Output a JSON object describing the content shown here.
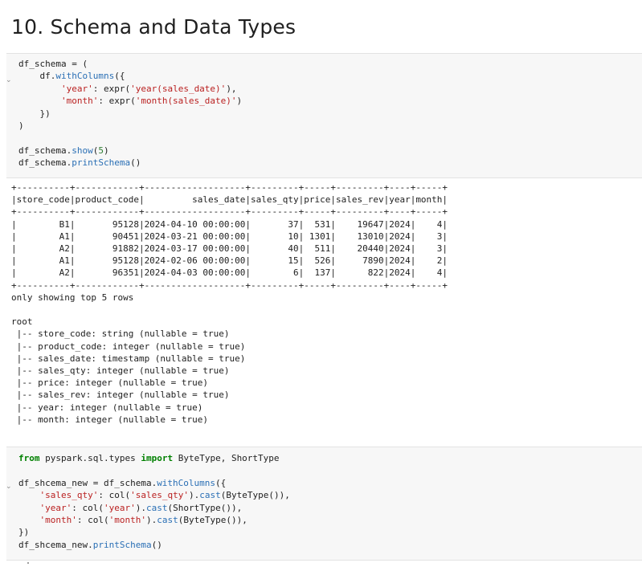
{
  "heading": "10. Schema and Data Types",
  "cell1": {
    "collapse_icon": "⌄",
    "lines": [
      [
        {
          "t": "df_schema = ("
        }
      ],
      [
        {
          "t": "    df."
        },
        {
          "t": "withColumns",
          "c": "fn"
        },
        {
          "t": "({"
        }
      ],
      [
        {
          "t": "        "
        },
        {
          "t": "'year'",
          "c": "st"
        },
        {
          "t": ": expr("
        },
        {
          "t": "'year(sales_date)'",
          "c": "st"
        },
        {
          "t": "),"
        }
      ],
      [
        {
          "t": "        "
        },
        {
          "t": "'month'",
          "c": "st"
        },
        {
          "t": ": expr("
        },
        {
          "t": "'month(sales_date)'",
          "c": "st"
        },
        {
          "t": ")"
        }
      ],
      [
        {
          "t": "    })"
        }
      ],
      [
        {
          "t": ")"
        }
      ],
      [
        {
          "t": ""
        }
      ],
      [
        {
          "t": "df_schema."
        },
        {
          "t": "show",
          "c": "fn"
        },
        {
          "t": "("
        },
        {
          "t": "5",
          "c": "nm"
        },
        {
          "t": ")"
        }
      ],
      [
        {
          "t": "df_schema."
        },
        {
          "t": "printSchema",
          "c": "fn"
        },
        {
          "t": "()"
        }
      ]
    ]
  },
  "output": {
    "table_lines": [
      "+----------+------------+-------------------+---------+-----+---------+----+-----+",
      "|store_code|product_code|         sales_date|sales_qty|price|sales_rev|year|month|",
      "+----------+------------+-------------------+---------+-----+---------+----+-----+",
      "|        B1|       95128|2024-04-10 00:00:00|       37|  531|    19647|2024|    4|",
      "|        A1|       90451|2024-03-21 00:00:00|       10| 1301|    13010|2024|    3|",
      "|        A2|       91882|2024-03-17 00:00:00|       40|  511|    20440|2024|    3|",
      "|        A1|       95128|2024-02-06 00:00:00|       15|  526|     7890|2024|    2|",
      "|        A2|       96351|2024-04-03 00:00:00|        6|  137|      822|2024|    4|",
      "+----------+------------+-------------------+---------+-----+---------+----+-----+"
    ],
    "note": "only showing top 5 rows",
    "schema_lines": [
      "root",
      " |-- store_code: string (nullable = true)",
      " |-- product_code: integer (nullable = true)",
      " |-- sales_date: timestamp (nullable = true)",
      " |-- sales_qty: integer (nullable = true)",
      " |-- price: integer (nullable = true)",
      " |-- sales_rev: integer (nullable = true)",
      " |-- year: integer (nullable = true)",
      " |-- month: integer (nullable = true)"
    ]
  },
  "cell2": {
    "collapse_icon": "⌄",
    "lines": [
      [
        {
          "t": "from",
          "c": "kw"
        },
        {
          "t": " pyspark.sql.types "
        },
        {
          "t": "import",
          "c": "kw"
        },
        {
          "t": " ByteType, ShortType"
        }
      ],
      [
        {
          "t": ""
        }
      ],
      [
        {
          "t": "df_shcema_new = df_schema."
        },
        {
          "t": "withColumns",
          "c": "fn"
        },
        {
          "t": "({"
        }
      ],
      [
        {
          "t": "    "
        },
        {
          "t": "'sales_qty'",
          "c": "st"
        },
        {
          "t": ": col("
        },
        {
          "t": "'sales_qty'",
          "c": "st"
        },
        {
          "t": ")."
        },
        {
          "t": "cast",
          "c": "fn"
        },
        {
          "t": "(ByteType()),"
        }
      ],
      [
        {
          "t": "    "
        },
        {
          "t": "'year'",
          "c": "st"
        },
        {
          "t": ": col("
        },
        {
          "t": "'year'",
          "c": "st"
        },
        {
          "t": ")."
        },
        {
          "t": "cast",
          "c": "fn"
        },
        {
          "t": "(ShortType()),"
        }
      ],
      [
        {
          "t": "    "
        },
        {
          "t": "'month'",
          "c": "st"
        },
        {
          "t": ": col("
        },
        {
          "t": "'month'",
          "c": "st"
        },
        {
          "t": ")."
        },
        {
          "t": "cast",
          "c": "fn"
        },
        {
          "t": "(ByteType()),"
        }
      ],
      [
        {
          "t": "})"
        }
      ],
      [
        {
          "t": "df_shcema_new."
        },
        {
          "t": "printSchema",
          "c": "fn"
        },
        {
          "t": "()"
        }
      ]
    ]
  }
}
